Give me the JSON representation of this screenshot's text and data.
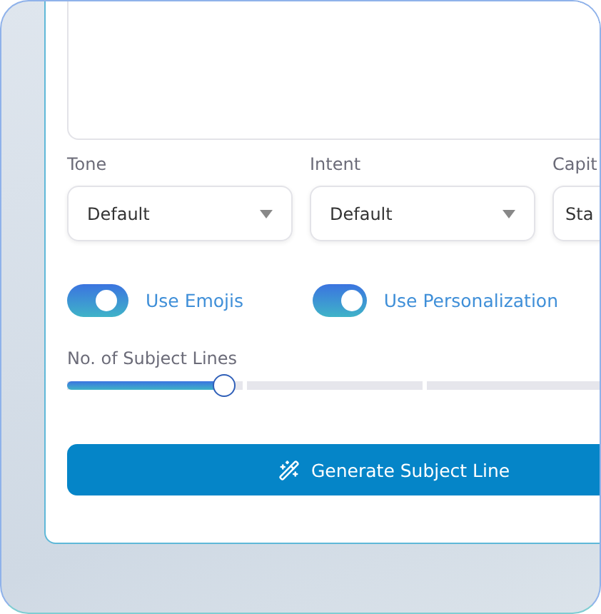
{
  "selects": [
    {
      "label": "Tone",
      "value": "Default"
    },
    {
      "label": "Intent",
      "value": "Default"
    },
    {
      "label": "Capit",
      "value": "Sta"
    }
  ],
  "toggles": [
    {
      "label": "Use Emojis",
      "on": true
    },
    {
      "label": "Use Personalization",
      "on": true
    }
  ],
  "slider": {
    "label": "No. of Subject Lines",
    "level": 0.22
  },
  "button": {
    "label": "Generate Subject Line"
  }
}
